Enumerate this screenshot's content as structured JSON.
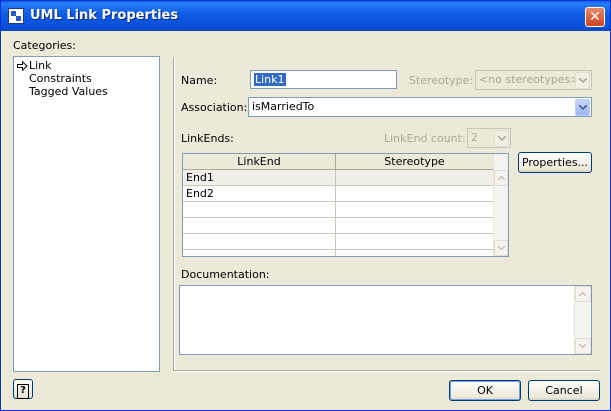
{
  "window": {
    "title": "UML Link Properties"
  },
  "categories": {
    "label": "Categories:",
    "items": [
      "Link",
      "Constraints",
      "Tagged Values"
    ]
  },
  "form": {
    "name_label": "Name:",
    "name_value": "Link1",
    "stereotype_label": "Stereotype:",
    "stereotype_value": "<no stereotypes>",
    "association_label": "Association:",
    "association_value": "isMarriedTo",
    "linkends_label": "LinkEnds:",
    "linkend_count_label": "LinkEnd count:",
    "linkend_count_value": "2",
    "properties_button": "Properties...",
    "documentation_label": "Documentation:"
  },
  "linkends_table": {
    "columns": [
      "LinkEnd",
      "Stereotype"
    ],
    "rows": [
      [
        "End1",
        ""
      ],
      [
        "End2",
        ""
      ],
      [
        "",
        ""
      ],
      [
        "",
        ""
      ],
      [
        "",
        ""
      ]
    ]
  },
  "footer": {
    "help_icon": "?",
    "ok_label": "OK",
    "cancel_label": "Cancel"
  },
  "colors": {
    "titlebar": "#0a50d8",
    "selection": "#316ac5",
    "dialog_bg": "#ece9d8"
  }
}
